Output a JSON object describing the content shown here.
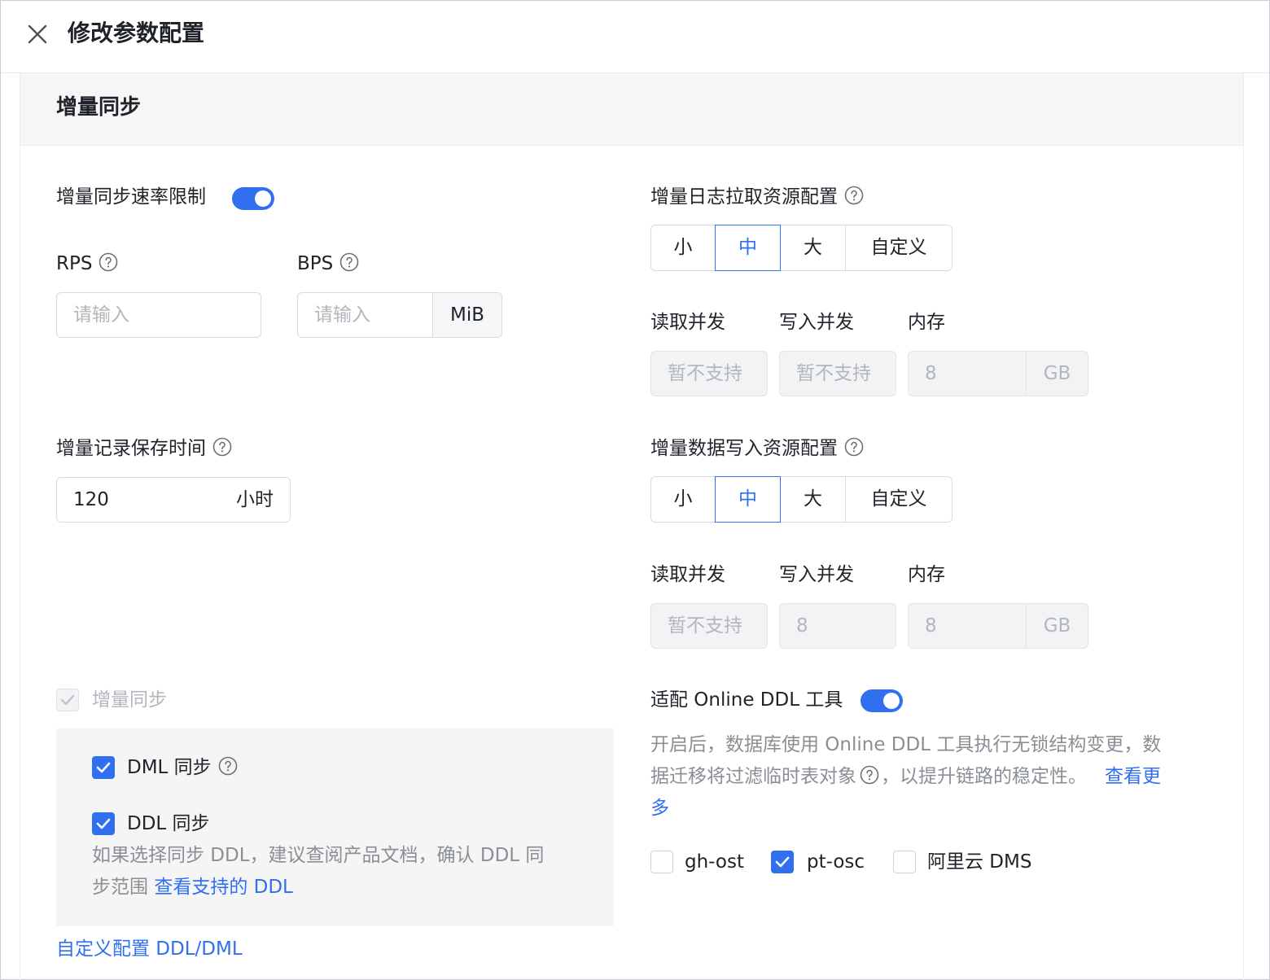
{
  "header": {
    "title": "修改参数配置"
  },
  "section": {
    "title": "增量同步"
  },
  "rate_limit": {
    "label": "增量同步速率限制",
    "enabled": true
  },
  "rps": {
    "label": "RPS",
    "placeholder": "请输入"
  },
  "bps": {
    "label": "BPS",
    "placeholder": "请输入",
    "unit": "MiB"
  },
  "retention": {
    "label": "增量记录保存时间",
    "value": "120",
    "unit": "小时"
  },
  "log_pull": {
    "label": "增量日志拉取资源配置",
    "options": [
      "小",
      "中",
      "大",
      "自定义"
    ],
    "selected": "中",
    "read_label": "读取并发",
    "write_label": "写入并发",
    "memory_label": "内存",
    "read_value": "暂不支持",
    "write_value": "暂不支持",
    "memory_value": "8",
    "memory_unit": "GB"
  },
  "data_write": {
    "label": "增量数据写入资源配置",
    "options": [
      "小",
      "中",
      "大",
      "自定义"
    ],
    "selected": "中",
    "read_label": "读取并发",
    "write_label": "写入并发",
    "memory_label": "内存",
    "read_value": "暂不支持",
    "write_value": "8",
    "memory_value": "8",
    "memory_unit": "GB"
  },
  "incremental_sync": {
    "label": "增量同步",
    "checked": true,
    "disabled": true
  },
  "dml_sync": {
    "label": "DML 同步",
    "checked": true
  },
  "ddl_sync": {
    "label": "DDL 同步",
    "checked": true,
    "desc_line1": "如果选择同步 DDL，建议查阅产品文档，确认 DDL 同",
    "desc_line2": "步范围 ",
    "link": "查看支持的 DDL"
  },
  "custom_config_link": "自定义配置 DDL/DML",
  "online_ddl": {
    "label": "适配 Online DDL 工具",
    "enabled": true,
    "desc_line1": "开启后，数据库使用 Online DDL 工具执行无锁结构变更，数",
    "desc_line2a": "据迁移将过滤临时表对象",
    "desc_line2b": "，以提升链路的稳定性。",
    "more_link_a": "查看更",
    "more_link_b": "多",
    "tools": [
      {
        "label": "gh-ost",
        "checked": false
      },
      {
        "label": "pt-osc",
        "checked": true
      },
      {
        "label": "阿里云 DMS",
        "checked": false
      }
    ]
  },
  "colors": {
    "accent": "#2f6ff0",
    "border": "#d8dbe0",
    "muted": "#8a8e95",
    "disabled_bg": "#f2f3f5"
  },
  "icons": [
    "close-icon",
    "question-icon",
    "check-icon"
  ]
}
